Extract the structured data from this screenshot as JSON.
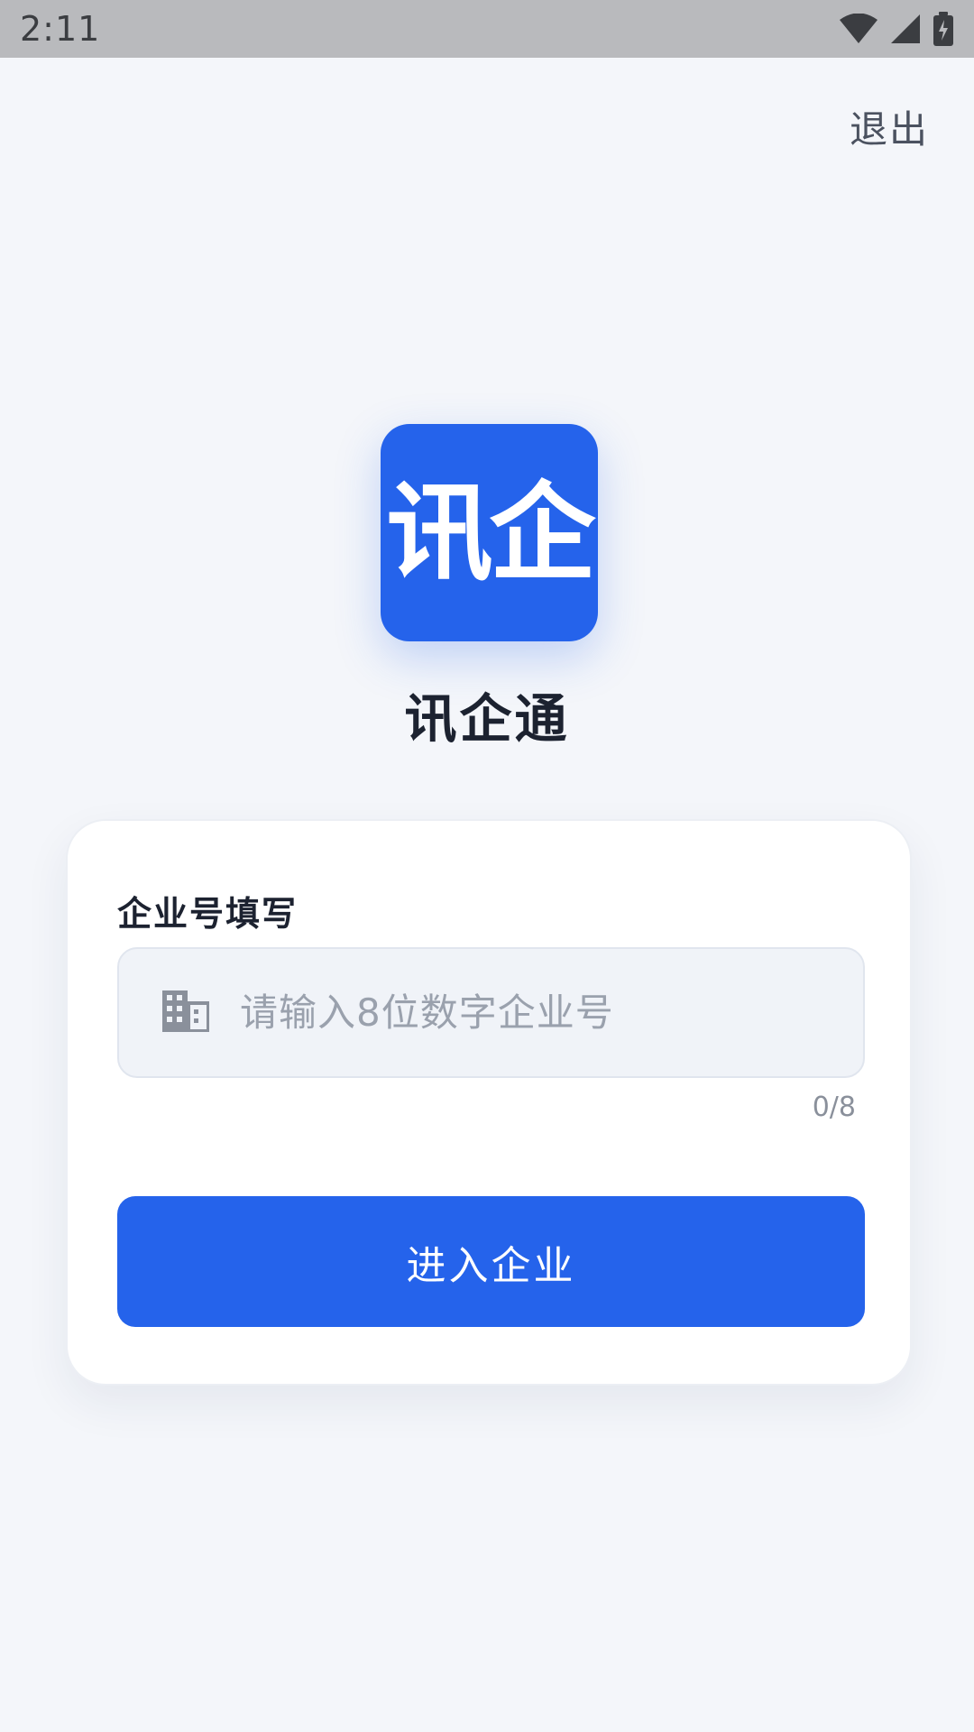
{
  "status_bar": {
    "time": "2:11",
    "icons": [
      "wifi-icon",
      "cellular-signal-icon",
      "battery-charging-icon"
    ]
  },
  "header": {
    "exit_label": "退出"
  },
  "app": {
    "logo_text": "讯企",
    "name": "讯企通"
  },
  "form": {
    "label": "企业号填写",
    "input": {
      "value": "",
      "placeholder": "请输入8位数字企业号",
      "icon": "building-icon",
      "counter": "0/8"
    },
    "submit_label": "进入企业"
  },
  "colors": {
    "accent": "#2563eb",
    "background": "#f4f6fa",
    "status_bar": "#b9babd"
  }
}
